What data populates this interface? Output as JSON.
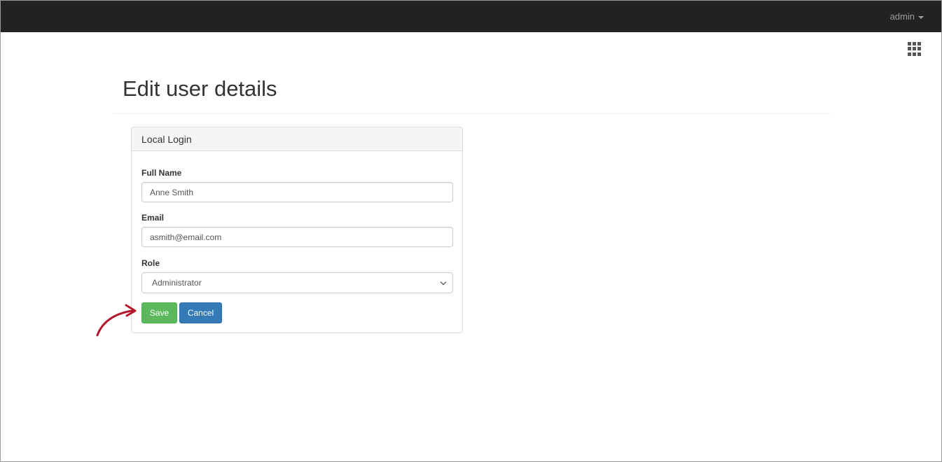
{
  "navbar": {
    "user_menu_label": "admin"
  },
  "page": {
    "title": "Edit user details"
  },
  "panel": {
    "heading": "Local Login",
    "fields": {
      "full_name": {
        "label": "Full Name",
        "value": "Anne Smith"
      },
      "email": {
        "label": "Email",
        "value": "asmith@email.com"
      },
      "role": {
        "label": "Role",
        "selected": "Administrator"
      }
    },
    "buttons": {
      "save": "Save",
      "cancel": "Cancel"
    }
  },
  "colors": {
    "navbar_bg": "#222222",
    "save_green": "#5cb85c",
    "cancel_blue": "#337ab7",
    "annotation_arrow": "#b3182d"
  },
  "icons": {
    "apps": "grid-icon",
    "user_menu": "caret-down-icon",
    "select": "chevron-down-icon",
    "annotation": "curved-arrow-icon"
  }
}
